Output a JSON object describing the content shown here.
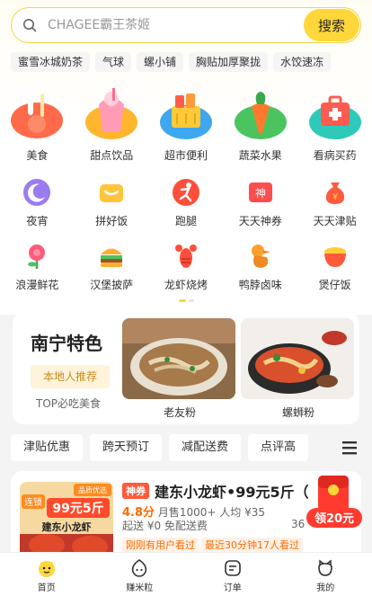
{
  "search": {
    "placeholder": "CHAGEE霸王茶姬",
    "button": "搜索"
  },
  "chips": [
    "蜜雪冰城奶茶",
    "气球",
    "螺小铺",
    "胸贴加厚聚拢",
    "水饺速冻"
  ],
  "categories_big": [
    "美食",
    "甜点饮品",
    "超市便利",
    "蔬菜水果",
    "看病买药"
  ],
  "categories_row2": [
    "夜宵",
    "拼好饭",
    "跑腿",
    "天天神券",
    "天天津贴"
  ],
  "categories_row3": [
    "浪漫鲜花",
    "汉堡披萨",
    "龙虾烧烤",
    "鸭脖卤味",
    "煲仔饭"
  ],
  "local": {
    "title": "南宁特色",
    "badge": "本地人推荐",
    "subtitle": "TOP必吃美食",
    "foods": [
      "老友粉",
      "螺蛳粉"
    ]
  },
  "filters": [
    "津贴优惠",
    "跨天预订",
    "减配送费",
    "点评高"
  ],
  "store": {
    "tag": "神券",
    "name": "建东小龙虾•99元5斤（",
    "score": "4.8分",
    "sales": "月售1000+",
    "avg": "人均 ¥35",
    "fee": "起送 ¥0  免配送费",
    "distance": "36",
    "seen1": "刚刚有用户看过",
    "seen2": "最近30分钟17人看过",
    "img_tag1": "连锁",
    "img_tag2": "品质优选",
    "img_price": "99元5斤",
    "img_brand": "建东小龙虾"
  },
  "red_packet": {
    "amount": "领20元"
  },
  "bottom_nav": [
    "首页",
    "赚米粒",
    "订单",
    "我的"
  ],
  "colors": {
    "accent": "#ffd73a",
    "orange": "#ff6b00",
    "red": "#ff5a3c"
  }
}
